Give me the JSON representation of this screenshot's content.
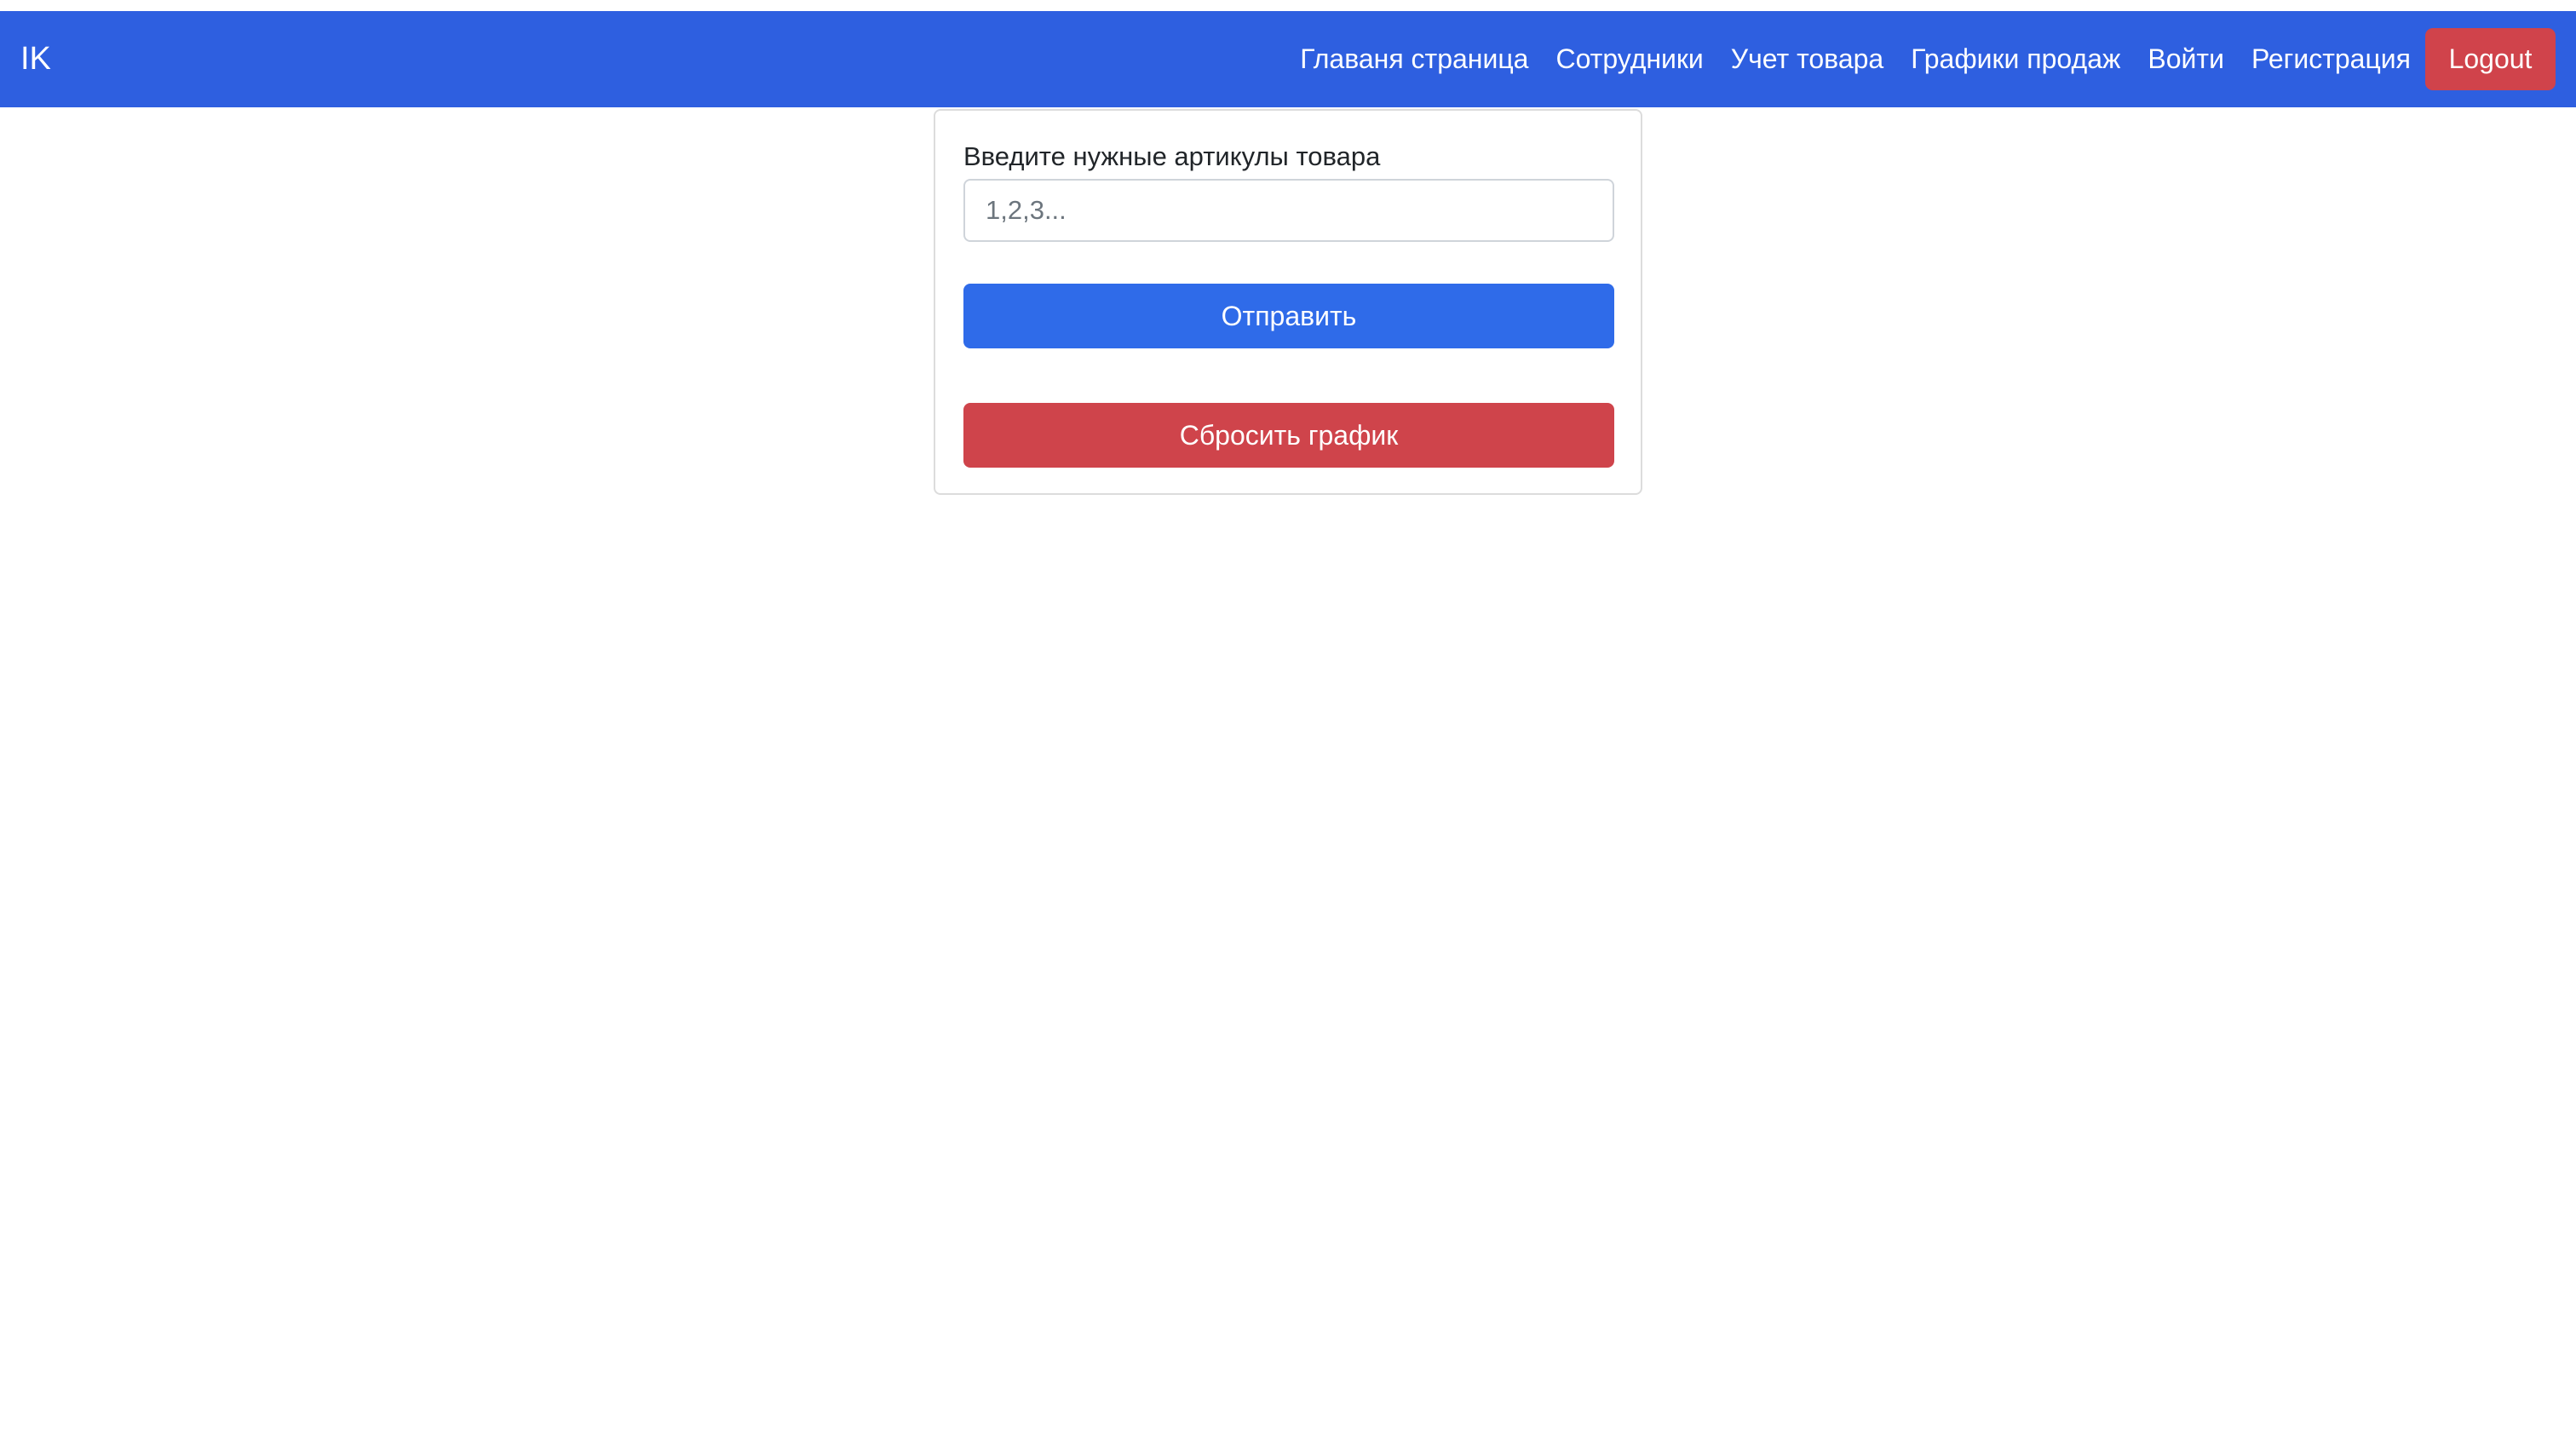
{
  "navbar": {
    "brand": "IK",
    "links": [
      {
        "label": "Главаня страница"
      },
      {
        "label": "Сотрудники"
      },
      {
        "label": "Учет товара"
      },
      {
        "label": "Графики продаж"
      },
      {
        "label": "Войти"
      },
      {
        "label": "Регистрация"
      }
    ],
    "logout_label": "Logout"
  },
  "form": {
    "label": "Введите нужные артикулы товара",
    "input_value": "",
    "input_placeholder": "1,2,3...",
    "submit_label": "Отправить",
    "reset_label": "Сбросить график"
  },
  "colors": {
    "navbar_bg": "#2e5fe0",
    "primary": "#2f6be9",
    "danger": "#cf444b"
  }
}
